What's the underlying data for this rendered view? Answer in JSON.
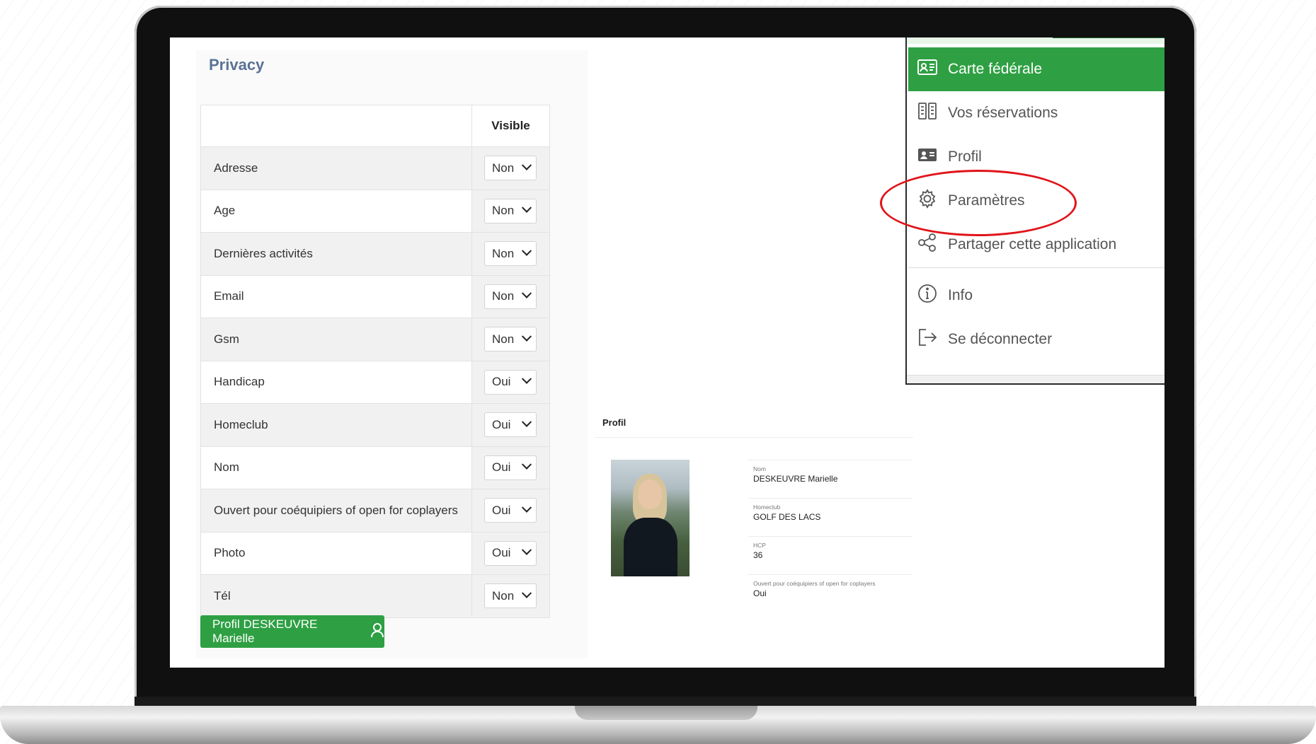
{
  "privacy": {
    "title": "Privacy",
    "column_header": "Visible",
    "rows": [
      {
        "label": "Adresse",
        "value": "Non"
      },
      {
        "label": "Age",
        "value": "Non"
      },
      {
        "label": "Dernières activités",
        "value": "Non"
      },
      {
        "label": "Email",
        "value": "Non"
      },
      {
        "label": "Gsm",
        "value": "Non"
      },
      {
        "label": "Handicap",
        "value": "Oui"
      },
      {
        "label": "Homeclub",
        "value": "Oui"
      },
      {
        "label": "Nom",
        "value": "Oui"
      },
      {
        "label": "Ouvert pour coéquipiers of open for coplayers",
        "value": "Oui"
      },
      {
        "label": "Photo",
        "value": "Oui"
      },
      {
        "label": "Tél",
        "value": "Non"
      }
    ],
    "profile_button": "Profil DESKEUVRE Marielle"
  },
  "profile_card": {
    "heading": "Profil",
    "fields": [
      {
        "key": "Nom",
        "value": "DESKEUVRE Marielle"
      },
      {
        "key": "Homeclub",
        "value": "GOLF DES LACS"
      },
      {
        "key": "HCP",
        "value": "36"
      },
      {
        "key": "Ouvert pour coéquipiers of open for coplayers",
        "value": "Oui"
      }
    ]
  },
  "menu": {
    "items": [
      {
        "label": "Carte fédérale",
        "icon": "id-card-icon"
      },
      {
        "label": "Vos réservations",
        "icon": "reservations-icon"
      },
      {
        "label": "Profil",
        "icon": "profile-card-icon"
      },
      {
        "label": "Paramètres",
        "icon": "gear-icon"
      },
      {
        "label": "Partager cette application",
        "icon": "share-icon"
      },
      {
        "label": "Info",
        "icon": "info-icon"
      },
      {
        "label": "Se déconnecter",
        "icon": "logout-icon"
      }
    ]
  },
  "colors": {
    "accent": "#2ea043",
    "title": "#5b7394",
    "highlight": "#e0141a"
  }
}
